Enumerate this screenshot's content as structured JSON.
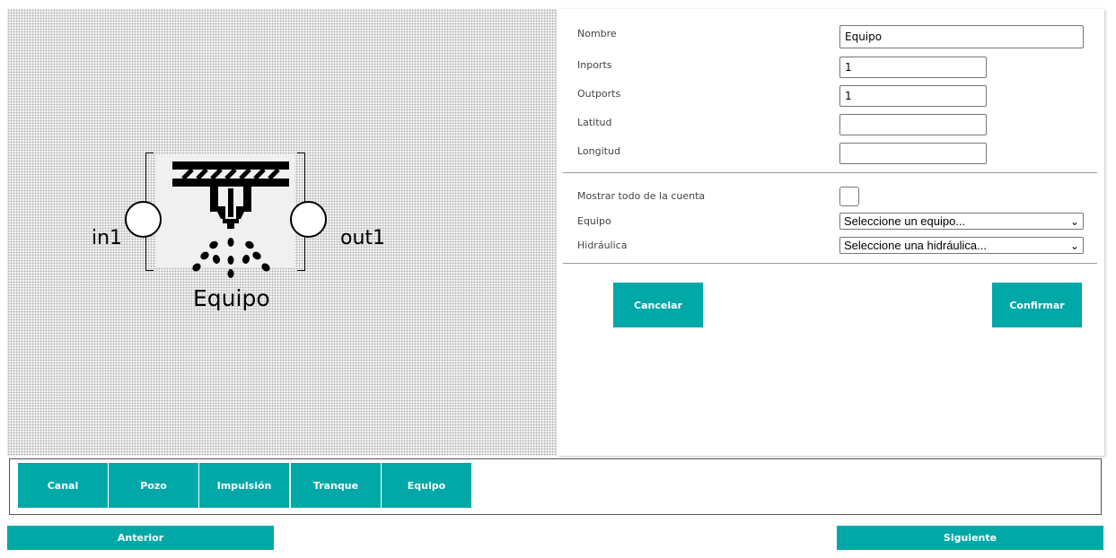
{
  "diagram": {
    "block_name": "Equipo",
    "input_port": "in1",
    "output_port": "out1",
    "icon": "sprinkler-icon"
  },
  "form": {
    "name_label": "Nombre",
    "name_value": "Equipo",
    "inports_label": "Inports",
    "inports_value": "1",
    "outports_label": "Outports",
    "outports_value": "1",
    "latitude_label": "Latitud",
    "latitude_value": "",
    "longitude_label": "Longitud",
    "longitude_value": "",
    "show_all_label": "Mostrar todo de la cuenta",
    "show_all_checked": false,
    "equipment_label": "Equipo",
    "equipment_selected": "Seleccione un equipo...",
    "hydraulic_label": "Hidráulica",
    "hydraulic_selected": "Seleccione una hidráulica...",
    "cancel_label": "Cancelar",
    "confirm_label": "Confirmar"
  },
  "palette": {
    "items": [
      "Canal",
      "Pozo",
      "Impulsión",
      "Tranque",
      "Equipo"
    ]
  },
  "navigation": {
    "previous_label": "Anterior",
    "next_label": "Siguiente"
  },
  "colors": {
    "accent": "#00a8a8",
    "canvas_bg": "#f3f3f3",
    "text": "#000000"
  }
}
